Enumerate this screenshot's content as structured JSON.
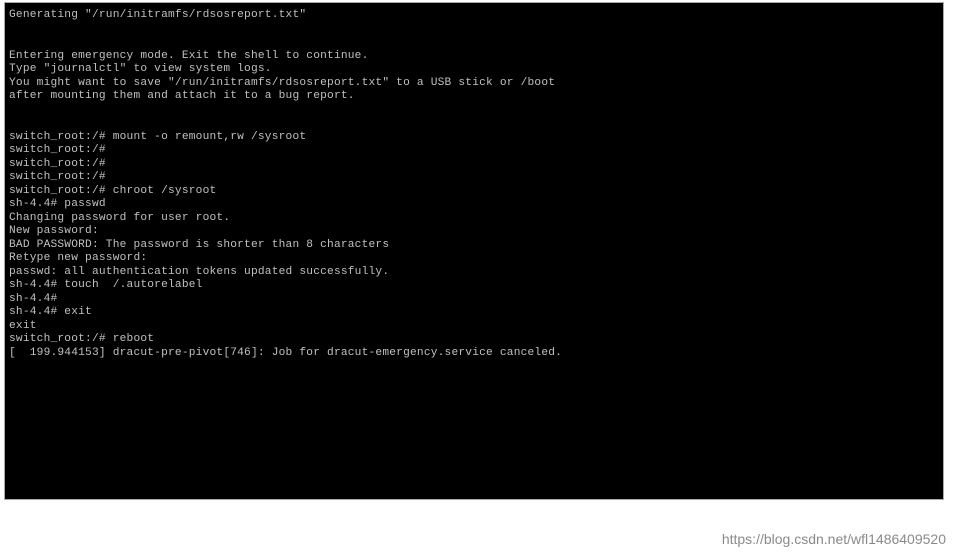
{
  "terminal": {
    "lines": [
      "Generating \"/run/initramfs/rdsosreport.txt\"",
      "",
      "",
      "Entering emergency mode. Exit the shell to continue.",
      "Type \"journalctl\" to view system logs.",
      "You might want to save \"/run/initramfs/rdsosreport.txt\" to a USB stick or /boot",
      "after mounting them and attach it to a bug report.",
      "",
      "",
      "switch_root:/# mount -o remount,rw /sysroot",
      "switch_root:/#",
      "switch_root:/#",
      "switch_root:/#",
      "switch_root:/# chroot /sysroot",
      "sh-4.4# passwd",
      "Changing password for user root.",
      "New password:",
      "BAD PASSWORD: The password is shorter than 8 characters",
      "Retype new password:",
      "passwd: all authentication tokens updated successfully.",
      "sh-4.4# touch  /.autorelabel",
      "sh-4.4#",
      "sh-4.4# exit",
      "exit",
      "switch_root:/# reboot",
      "[  199.944153] dracut-pre-pivot[746]: Job for dracut-emergency.service canceled."
    ]
  },
  "watermark": "https://blog.csdn.net/wfl1486409520"
}
